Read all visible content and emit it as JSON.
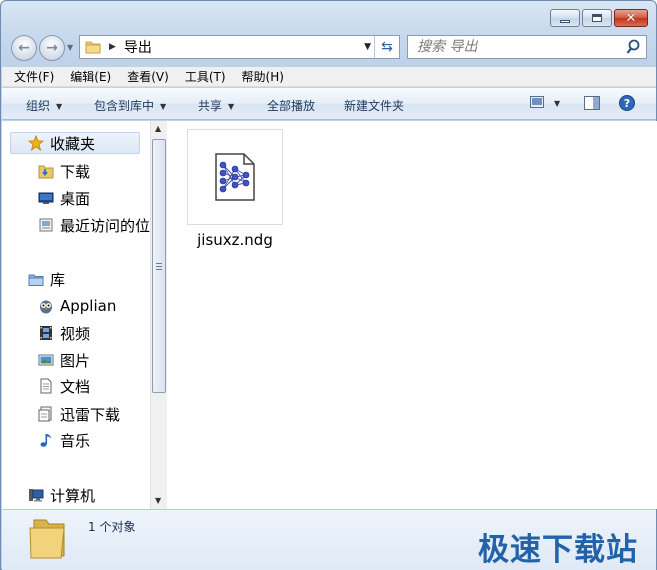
{
  "window": {
    "caption_buttons": [
      "minimize",
      "maximize",
      "close"
    ]
  },
  "address_bar": {
    "path": [
      "导出"
    ]
  },
  "search": {
    "placeholder": "搜索 导出"
  },
  "menu": [
    "文件(F)",
    "编辑(E)",
    "查看(V)",
    "工具(T)",
    "帮助(H)"
  ],
  "commands": {
    "organize": "组织",
    "include_in_library": "包含到库中",
    "share": "共享",
    "play_all": "全部播放",
    "new_folder": "新建文件夹"
  },
  "nav_pane": {
    "favorites": {
      "label": "收藏夹",
      "items": [
        "下载",
        "桌面",
        "最近访问的位置"
      ]
    },
    "libraries": {
      "label": "库",
      "items": [
        "Applian",
        "视频",
        "图片",
        "文档",
        "迅雷下载",
        "音乐"
      ]
    },
    "computer": {
      "label": "计算机"
    }
  },
  "files": [
    {
      "name": "jisuxz.ndg",
      "icon": "network-graph-file-icon"
    }
  ],
  "details_pane": {
    "status": "1 个对象",
    "watermark": "极速下载站"
  },
  "colors": {
    "window_frame": "#bfd2ea",
    "close_button": "#c0371c",
    "watermark": "#2262a8"
  }
}
